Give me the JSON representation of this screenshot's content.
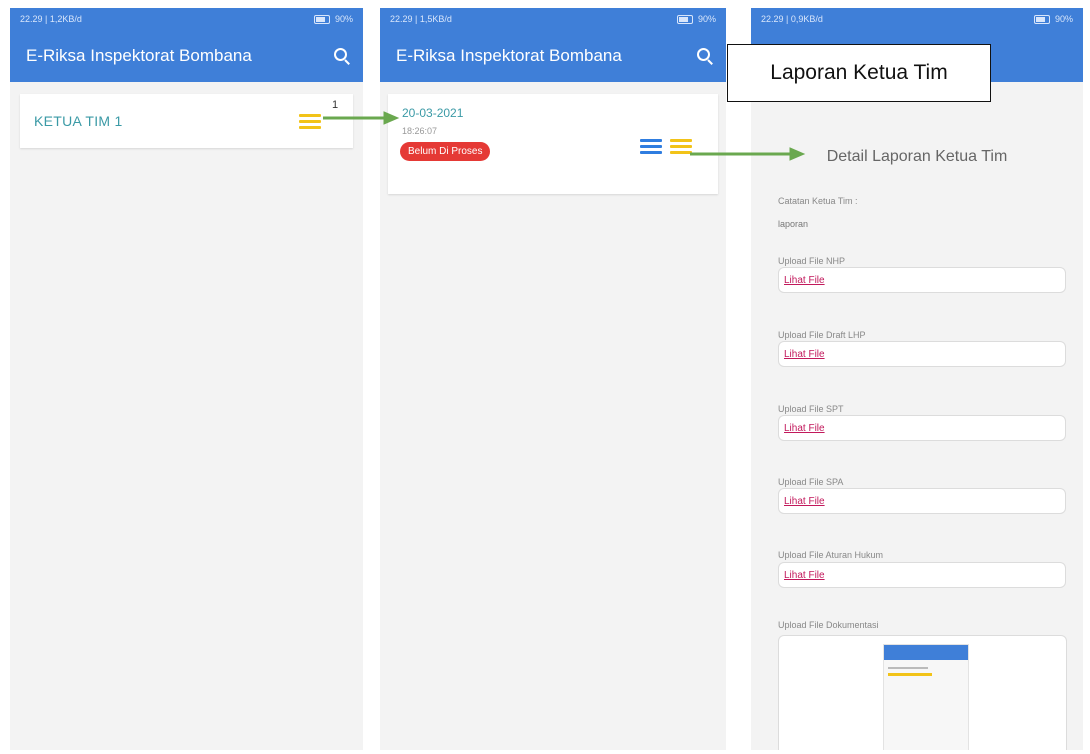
{
  "screens": [
    {
      "status": {
        "time": "22.29 | 1,2KB/d",
        "right": "90%"
      },
      "app_title": "E-Riksa Inspektorat Bombana",
      "item": {
        "title": "KETUA TIM 1",
        "count": "1"
      }
    },
    {
      "status": {
        "time": "22.29 | 1,5KB/d",
        "right": "90%"
      },
      "app_title": "E-Riksa Inspektorat Bombana",
      "report": {
        "date": "20-03-2021",
        "time": "18:26:07",
        "status_badge": "Belum Di Proses"
      }
    },
    {
      "status": {
        "time": "22.29 | 0,9KB/d",
        "right": "90%"
      },
      "heading": "Detail Laporan Ketua Tim",
      "note_label": "Catatan Ketua Tim :",
      "note_value": "laporan",
      "uploads": [
        {
          "label": "Upload File NHP",
          "link": "Lihat File"
        },
        {
          "label": "Upload File Draft LHP",
          "link": "Lihat File"
        },
        {
          "label": "Upload File SPT",
          "link": "Lihat File"
        },
        {
          "label": "Upload File SPA",
          "link": "Lihat File"
        },
        {
          "label": "Upload File Aturan Hukum",
          "link": "Lihat File"
        }
      ],
      "doc_label": "Upload File Dokumentasi"
    }
  ],
  "callout": "Laporan Ketua Tim",
  "colors": {
    "appbar": "#3f7fd8",
    "accent_text": "#3b9aa6",
    "badge": "#e53935",
    "arrow": "#6aa84f",
    "link": "#c2185b"
  }
}
